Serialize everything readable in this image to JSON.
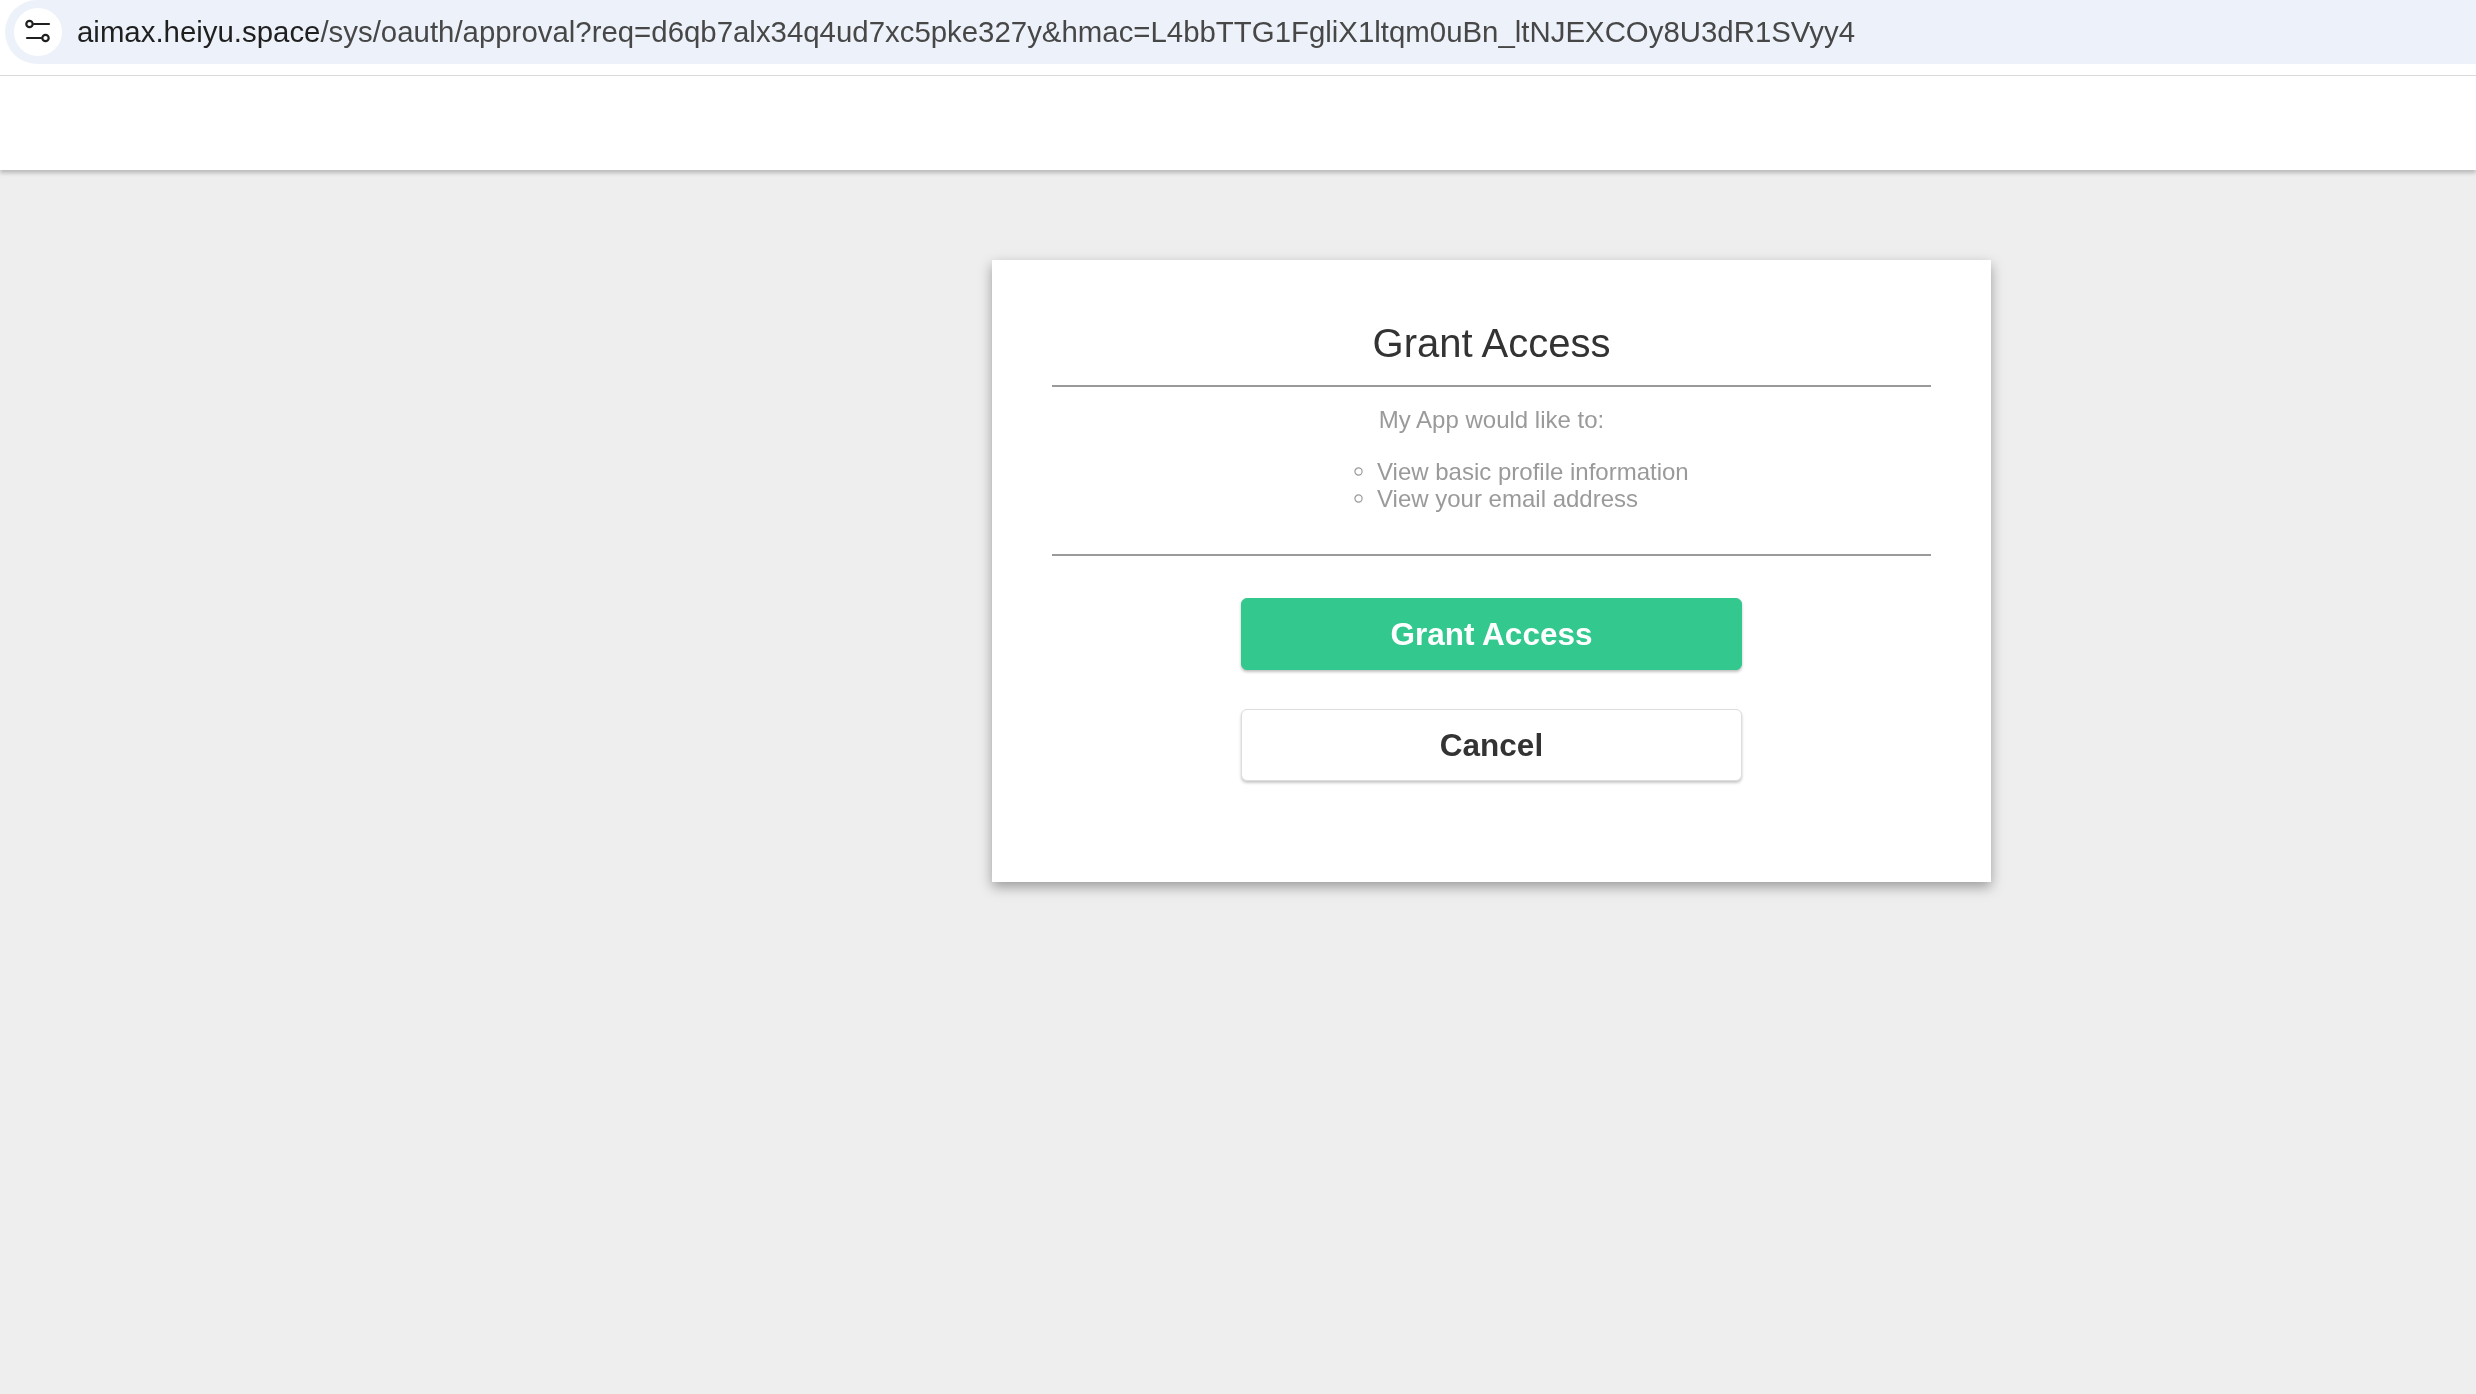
{
  "browser": {
    "url": {
      "host": "aimax.heiyu.space",
      "path": "/sys/oauth/approval?req=d6qb7alx34q4ud7xc5pke327y&hmac=L4bbTTG1FgliX1ltqm0uBn_ltNJEXCOy8U3dR1SVyy4"
    }
  },
  "dialog": {
    "title": "Grant Access",
    "intro": "My App would like to:",
    "permissions": [
      "View basic profile information",
      "View your email address"
    ],
    "buttons": [
      {
        "label": "Grant Access",
        "kind": "primary"
      },
      {
        "label": "Cancel",
        "kind": "secondary"
      }
    ]
  }
}
